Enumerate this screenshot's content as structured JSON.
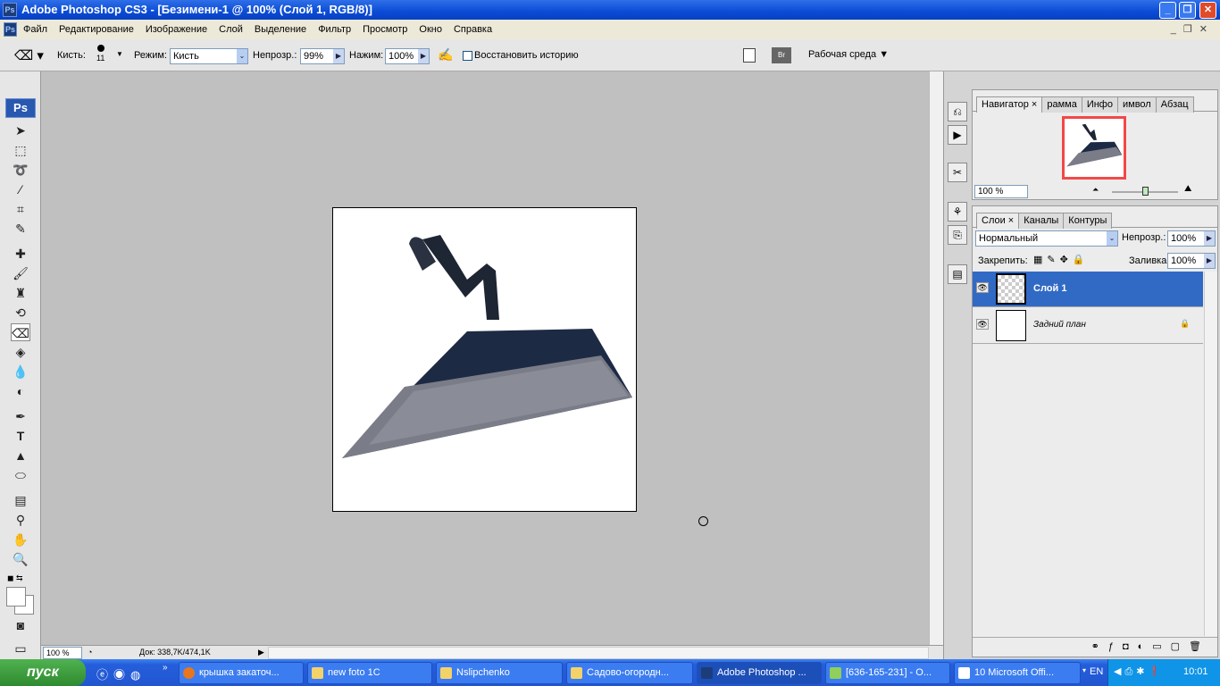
{
  "window": {
    "title": "Adobe Photoshop CS3 - [Безимени-1 @ 100% (Слой 1, RGB/8)]",
    "app_icon": "Ps"
  },
  "menu": [
    "Файл",
    "Редактирование",
    "Изображение",
    "Слой",
    "Выделение",
    "Фильтр",
    "Просмотр",
    "Окно",
    "Справка"
  ],
  "options": {
    "brush_label": "Кисть:",
    "brush_size": "11",
    "mode_label": "Режим:",
    "mode_value": "Кисть",
    "opacity_label": "Непрозр.:",
    "opacity_value": "99%",
    "flow_label": "Нажим:",
    "flow_value": "100%",
    "restore_history": "Восстановить историю",
    "workspace": "Рабочая среда ▼"
  },
  "toolbox": {
    "logo": "Ps"
  },
  "navigator": {
    "tabs": [
      "Навигатор",
      "рамма",
      "Инфо",
      "имвол",
      "Абзац"
    ],
    "zoom": "100 %",
    "zoom_slider": 0.55
  },
  "layers": {
    "tabs": [
      "Слои",
      "Каналы",
      "Контуры"
    ],
    "blend_mode": "Нормальный",
    "opacity_label": "Непрозр.:",
    "opacity": "100%",
    "lock_label": "Закрепить:",
    "fill_label": "Заливка:",
    "fill": "100%",
    "items": [
      {
        "name": "Слой 1",
        "selected": true
      },
      {
        "name": "Задний план",
        "selected": false
      }
    ]
  },
  "status": {
    "zoom": "100 %",
    "doc": "Док: 338,7K/474,1K"
  },
  "taskbar": {
    "start": "пуск",
    "tasks": [
      "крышка закаточ...",
      "new foto 1C",
      "Nslipchenko",
      "Садово-огородн...",
      "Adobe Photoshop ...",
      "[636-165-231] - О...",
      "10 Microsoft Offi..."
    ],
    "lang": "EN",
    "clock": "10:01"
  },
  "colors": {
    "selection": "#316ac5",
    "title": "#0a4bd6",
    "taskbar": "#245edb",
    "start": "#3c9a3c"
  }
}
